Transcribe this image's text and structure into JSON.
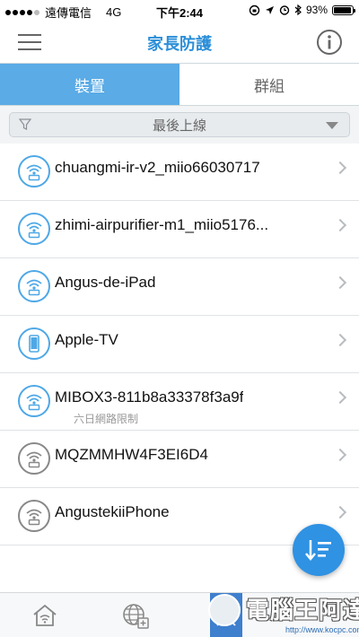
{
  "status_bar": {
    "carrier": "遠傳電信",
    "network": "4G",
    "time": "下午2:44",
    "battery": "93%",
    "battery_level": 0.93
  },
  "nav": {
    "title": "家長防護",
    "menu_icon": "hamburger-menu-icon",
    "info_icon": "info-circle-icon"
  },
  "tabs": [
    {
      "label": "裝置",
      "active": true
    },
    {
      "label": "群組",
      "active": false
    }
  ],
  "filter": {
    "label": "最後上線",
    "icon": "funnel-icon"
  },
  "devices": [
    {
      "name": "chuangmi-ir-v2_miio66030717",
      "icon": "wifi-device-icon",
      "status_color": "#4ea8e6",
      "note": ""
    },
    {
      "name": "zhimi-airpurifier-m1_miio5176...",
      "icon": "wifi-device-icon",
      "status_color": "#4ea8e6",
      "note": ""
    },
    {
      "name": "Angus-de-iPad",
      "icon": "wifi-device-icon",
      "status_color": "#4ea8e6",
      "note": ""
    },
    {
      "name": "Apple-TV",
      "icon": "phone-device-icon",
      "status_color": "#4ea8e6",
      "note": ""
    },
    {
      "name": "MIBOX3-811b8a33378f3a9f",
      "icon": "wifi-device-icon",
      "status_color": "#4ea8e6",
      "note": "六日網路限制"
    },
    {
      "name": "MQZMMHW4F3EI6D4",
      "icon": "wifi-device-icon",
      "status_color": "#888888",
      "note": ""
    },
    {
      "name": "AngustekiiPhone",
      "icon": "wifi-device-icon",
      "status_color": "#888888",
      "note": ""
    }
  ],
  "fab": {
    "icon": "sort-descending-icon"
  },
  "bottom_tabs": [
    {
      "icon": "home-wifi-icon"
    },
    {
      "icon": "globe-add-icon"
    },
    {
      "icon": "profile-icon"
    }
  ],
  "watermark": {
    "text": "電腦王阿達",
    "url": "http://www.kocpc.com.tw"
  },
  "colors": {
    "accent": "#2c8fd8",
    "tab_active": "#5aabe6",
    "fab": "#2f92e3"
  }
}
